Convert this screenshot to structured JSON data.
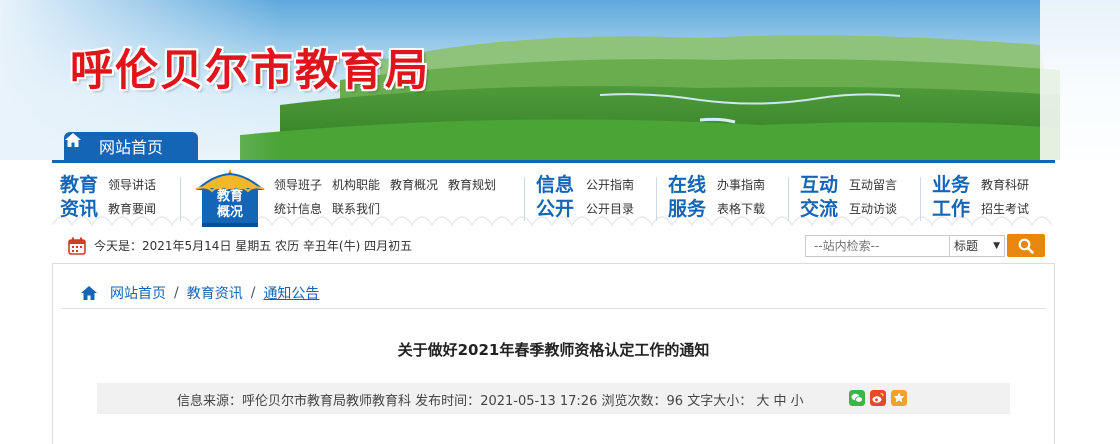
{
  "site": {
    "title": "呼伦贝尔市教育局"
  },
  "home_tab": {
    "label": "网站首页"
  },
  "nav": {
    "groups": [
      {
        "cat1": "教育",
        "cat2": "资讯",
        "links": [
          "领导讲话",
          "教育要闻"
        ]
      },
      {
        "badge": "教育概况",
        "badge_line1": "教育",
        "badge_line2": "概况",
        "links": [
          "领导班子",
          "机构职能",
          "教育概况",
          "教育规划",
          "统计信息",
          "联系我们"
        ]
      },
      {
        "cat1": "信息",
        "cat2": "公开",
        "links": [
          "公开指南",
          "公开目录"
        ]
      },
      {
        "cat1": "在线",
        "cat2": "服务",
        "links": [
          "办事指南",
          "表格下载"
        ]
      },
      {
        "cat1": "互动",
        "cat2": "交流",
        "links": [
          "互动留言",
          "互动访谈"
        ]
      },
      {
        "cat1": "业务",
        "cat2": "工作",
        "links": [
          "教育科研",
          "招生考试"
        ]
      }
    ]
  },
  "date_bar": {
    "text": "今天是：2021年5月14日 星期五 农历 辛丑年(牛) 四月初五"
  },
  "search": {
    "placeholder": "--站内检索--",
    "scope": "标题"
  },
  "breadcrumb": {
    "home": "网站首页",
    "section": "教育资讯",
    "current": "通知公告",
    "sep": "/"
  },
  "article": {
    "title": "关于做好2021年春季教师资格认定工作的通知",
    "meta": {
      "source_label": "信息来源：",
      "source": "呼伦贝尔市教育局教师教育科",
      "time_label": "发布时间：",
      "time": "2021-05-13 17:26",
      "views_label": "浏览次数：",
      "views": "96",
      "font_label": "文字大小：",
      "font_large": "大",
      "font_medium": "中",
      "font_small": "小"
    }
  },
  "colors": {
    "brand_blue": "#1565b7",
    "title_red": "#e0151b",
    "search_orange": "#e8870e",
    "wechat_green": "#3bb54a",
    "weibo_red": "#e6492e",
    "fav_orange": "#f2a12b"
  },
  "icons": [
    "home-icon",
    "calendar-icon",
    "search-icon",
    "yurt-icon",
    "wechat-icon",
    "weibo-icon",
    "favorite-icon"
  ]
}
